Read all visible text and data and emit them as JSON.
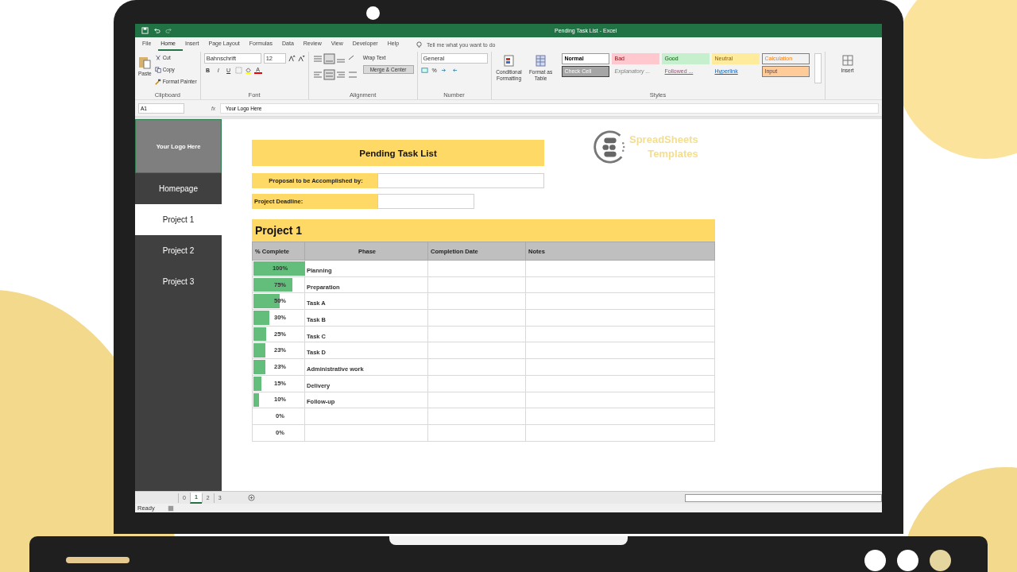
{
  "window": {
    "title": "Pending Task List - Excel"
  },
  "ribbon": {
    "tabs": [
      {
        "label": "File",
        "selected": false
      },
      {
        "label": "Home",
        "selected": true
      },
      {
        "label": "Insert",
        "selected": false
      },
      {
        "label": "Page Layout",
        "selected": false
      },
      {
        "label": "Formulas",
        "selected": false
      },
      {
        "label": "Data",
        "selected": false
      },
      {
        "label": "Review",
        "selected": false
      },
      {
        "label": "View",
        "selected": false
      },
      {
        "label": "Developer",
        "selected": false
      },
      {
        "label": "Help",
        "selected": false
      }
    ],
    "tell_me": "Tell me what you want to do",
    "clipboard": {
      "paste": "Paste",
      "cut": "Cut",
      "copy": "Copy",
      "format_painter": "Format Painter",
      "label": "Clipboard"
    },
    "font": {
      "name": "Bahnschrift",
      "size": "12",
      "bold": "B",
      "italic": "I",
      "underline": "U",
      "color_button": "A",
      "label": "Font"
    },
    "alignment": {
      "wrap": "Wrap Text",
      "merge": "Merge & Center",
      "label": "Alignment"
    },
    "number": {
      "format": "General",
      "percent": "%",
      "label": "Number"
    },
    "styles": {
      "conditional": "Conditional Formatting",
      "format_table": "Format as Table",
      "label": "Styles",
      "cells": [
        {
          "label": "Normal",
          "kind": "normal"
        },
        {
          "label": "Bad",
          "kind": "bad"
        },
        {
          "label": "Good",
          "kind": "good"
        },
        {
          "label": "Neutral",
          "kind": "neutral"
        },
        {
          "label": "Calculation",
          "kind": "calculation"
        },
        {
          "label": "Check Cell",
          "kind": "check"
        },
        {
          "label": "Explanatory ...",
          "kind": "explanatory"
        },
        {
          "label": "Followed ...",
          "kind": "followed"
        },
        {
          "label": "Hyperlink",
          "kind": "hyperlink"
        },
        {
          "label": "Input",
          "kind": "input"
        }
      ]
    },
    "insert": "Insert"
  },
  "formula_bar": {
    "name_box": "A1",
    "fx": "fx",
    "value": "Your Logo Here"
  },
  "sidebar": {
    "logo": "Your Logo Here",
    "items": [
      {
        "label": "Homepage",
        "selected": false
      },
      {
        "label": "Project 1",
        "selected": true
      },
      {
        "label": "Project 2",
        "selected": false
      },
      {
        "label": "Project 3",
        "selected": false
      }
    ]
  },
  "sheet": {
    "title": "Pending Task List",
    "brand": [
      "SpreadSheets",
      "Templates"
    ],
    "fields": [
      {
        "label": "Proposal to be Accomplished by:",
        "wide": true
      },
      {
        "label": "Project Deadline:",
        "wide": false
      }
    ],
    "section": "Project 1",
    "columns": [
      "% Complete",
      "Phase",
      "Completion Date",
      "Notes"
    ],
    "rows": [
      {
        "percent": "100%",
        "level": 1,
        "phase": "Planning"
      },
      {
        "percent": "75%",
        "level": 0.75,
        "phase": "Preparation"
      },
      {
        "percent": "50%",
        "level": 0.5,
        "phase": "Task A"
      },
      {
        "percent": "30%",
        "level": 0.3,
        "phase": "Task B"
      },
      {
        "percent": "25%",
        "level": 0.25,
        "phase": "Task C"
      },
      {
        "percent": "23%",
        "level": 0.23,
        "phase": "Task D"
      },
      {
        "percent": "23%",
        "level": 0.23,
        "phase": "Administrative work"
      },
      {
        "percent": "15%",
        "level": 0.15,
        "phase": "Delivery"
      },
      {
        "percent": "10%",
        "level": 0.1,
        "phase": "Follow-up"
      },
      {
        "percent": "0%"
      },
      {
        "percent": "0%"
      }
    ]
  },
  "sheet_tabs": [
    {
      "label": "0",
      "selected": false
    },
    {
      "label": "1",
      "selected": true
    },
    {
      "label": "2",
      "selected": false
    },
    {
      "label": "3",
      "selected": false
    }
  ],
  "status": "Ready"
}
